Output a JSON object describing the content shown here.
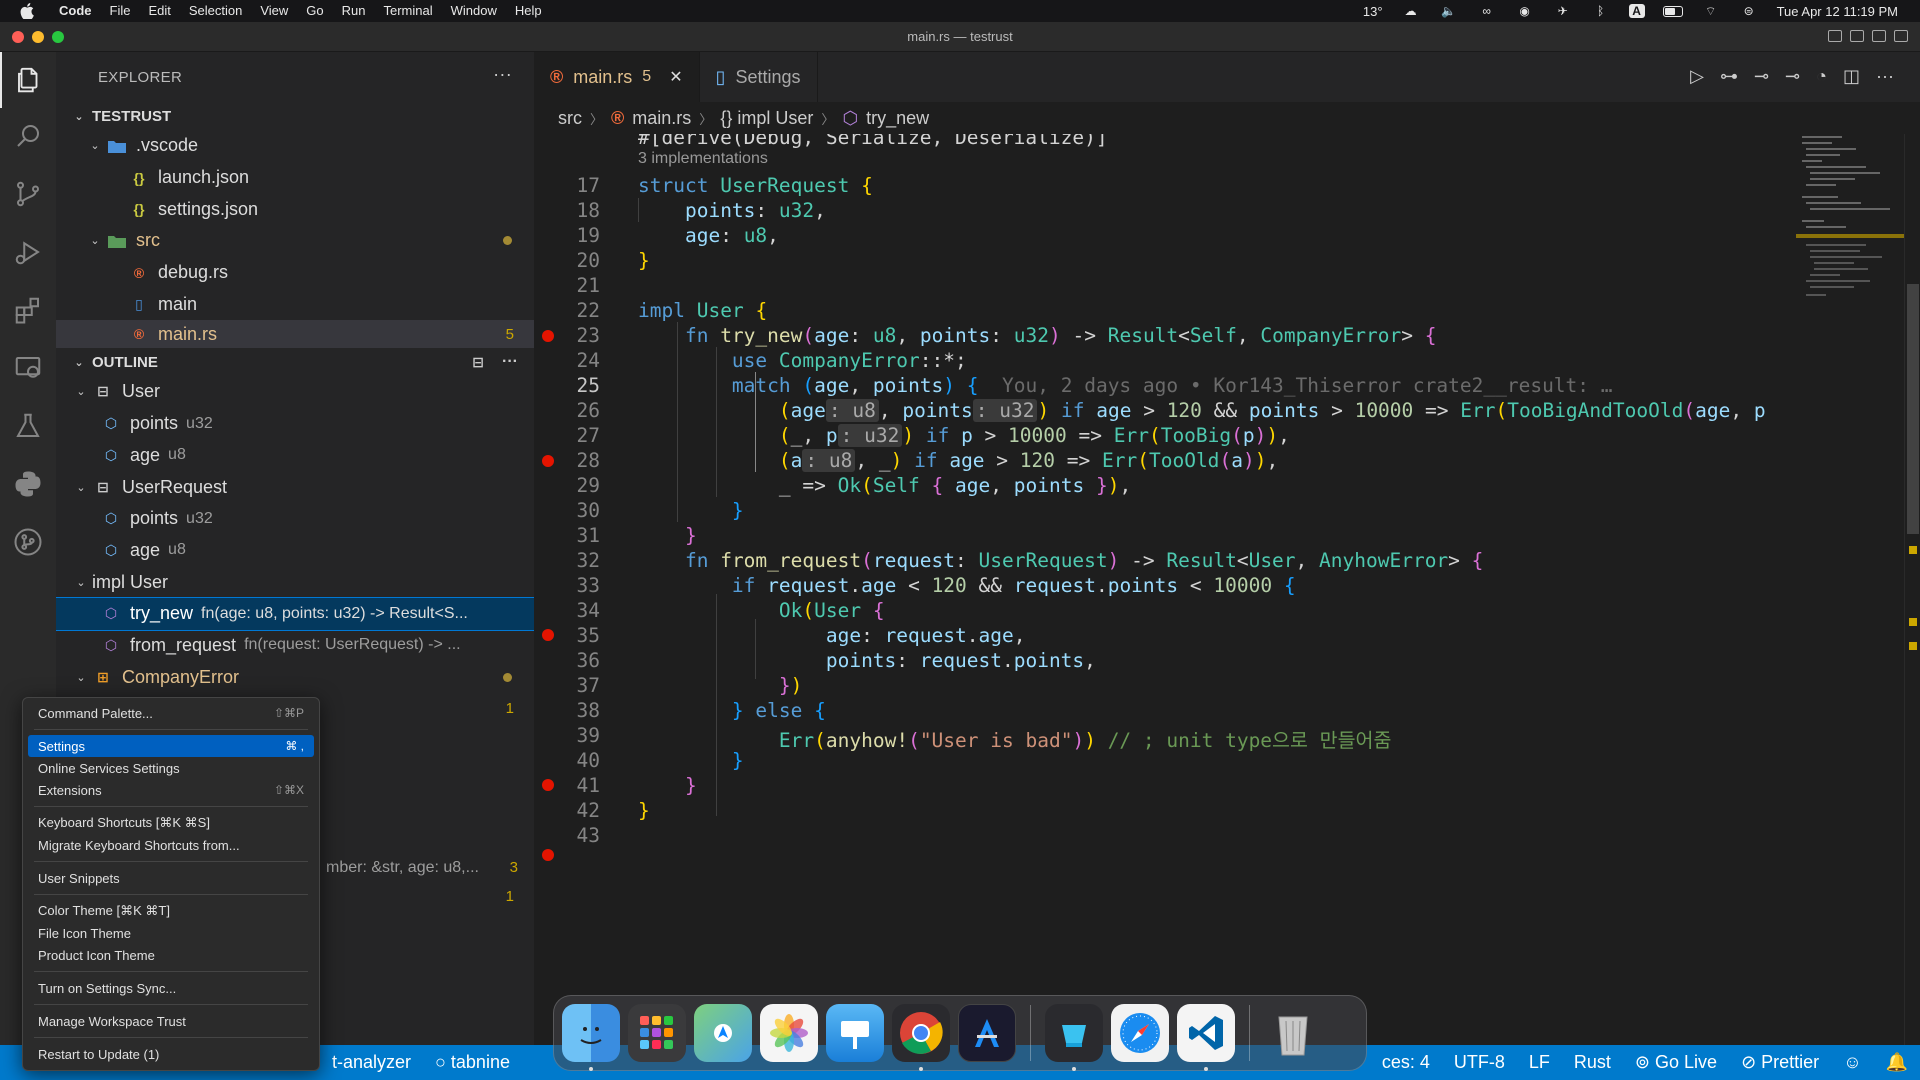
{
  "menubar": {
    "app": "Code",
    "items": [
      "File",
      "Edit",
      "Selection",
      "View",
      "Go",
      "Run",
      "Terminal",
      "Window",
      "Help"
    ],
    "weather": "13°",
    "datetime": "Tue Apr 12  11:19 PM"
  },
  "window": {
    "title": "main.rs — testrust"
  },
  "sidebar": {
    "explorer_title": "EXPLORER",
    "project": "TESTRUST",
    "tree": [
      {
        "label": ".vscode",
        "kind": "folder"
      },
      {
        "label": "launch.json",
        "kind": "json"
      },
      {
        "label": "settings.json",
        "kind": "json"
      },
      {
        "label": "src",
        "kind": "folder"
      },
      {
        "label": "debug.rs",
        "kind": "rust"
      },
      {
        "label": "main",
        "kind": "file"
      },
      {
        "label": "main.rs",
        "kind": "rust",
        "badge": "5"
      }
    ],
    "outline_title": "OUTLINE",
    "outline": [
      {
        "label": "User",
        "detail": ""
      },
      {
        "label": "points",
        "detail": "u32"
      },
      {
        "label": "age",
        "detail": "u8"
      },
      {
        "label": "UserRequest",
        "detail": ""
      },
      {
        "label": "points",
        "detail": "u32"
      },
      {
        "label": "age",
        "detail": "u8"
      },
      {
        "label": "impl User",
        "detail": ""
      },
      {
        "label": "try_new",
        "detail": "fn(age: u8, points: u32) -> Result<S..."
      },
      {
        "label": "from_request",
        "detail": "fn(request: UserRequest) -> ..."
      },
      {
        "label": "CompanyError",
        "detail": ""
      }
    ],
    "partial_rows": [
      {
        "detail": "mber: &str, age: u8,...",
        "badge": "3"
      },
      {
        "badge": "1"
      },
      {
        "badge": "1"
      }
    ]
  },
  "tabs": [
    {
      "label": "main.rs",
      "count": "5",
      "active": true
    },
    {
      "label": "Settings",
      "active": false
    }
  ],
  "breadcrumbs": [
    "src",
    "main.rs",
    "{} impl User",
    "try_new"
  ],
  "editor": {
    "partial_line": "#[derive(Debug, Serialize, Deserialize)]",
    "codelens": "3 implementations",
    "line_numbers": [
      "17",
      "18",
      "19",
      "20",
      "21",
      "22",
      "23",
      "24",
      "25",
      "26",
      "27",
      "28",
      "29",
      "30",
      "31",
      "32",
      "33",
      "34",
      "35",
      "36",
      "37",
      "38",
      "39",
      "40",
      "41",
      "42",
      "43"
    ],
    "blame": "You, 2 days ago • Kor143_Thiserror crate2__result: …",
    "string_literal": "\"User is bad\"",
    "comment": "// ; unit type으로 만들어줌"
  },
  "context_menu": {
    "items": [
      {
        "label": "Command Palette...",
        "shortcut": "⇧⌘P"
      },
      {
        "label": "Settings",
        "shortcut": "⌘ ,",
        "selected": true
      },
      {
        "label": "Online Services Settings",
        "shortcut": ""
      },
      {
        "label": "Extensions",
        "shortcut": "⇧⌘X"
      },
      {
        "label": "Keyboard Shortcuts [⌘K ⌘S]",
        "shortcut": ""
      },
      {
        "label": "Migrate Keyboard Shortcuts from...",
        "shortcut": ""
      },
      {
        "label": "User Snippets",
        "shortcut": ""
      },
      {
        "label": "Color Theme [⌘K ⌘T]",
        "shortcut": ""
      },
      {
        "label": "File Icon Theme",
        "shortcut": ""
      },
      {
        "label": "Product Icon Theme",
        "shortcut": ""
      },
      {
        "label": "Turn on Settings Sync...",
        "shortcut": ""
      },
      {
        "label": "Manage Workspace Trust",
        "shortcut": ""
      },
      {
        "label": "Restart to Update (1)",
        "shortcut": ""
      }
    ]
  },
  "statusbar": {
    "left": [
      "t-analyzer",
      "tabnine"
    ],
    "right": [
      "ces: 4",
      "UTF-8",
      "LF",
      "Rust",
      "Go Live",
      "Prettier"
    ]
  },
  "dock": [
    "finder-icon",
    "launchpad-icon",
    "maps-icon",
    "photos-icon",
    "keynote-icon",
    "chrome-icon",
    "xcode-icon",
    "dropzone-icon",
    "safari-icon",
    "vscode-icon",
    "trash-icon"
  ],
  "colors": {
    "accent": "#007acc",
    "selection": "#04395e",
    "modified": "#e2c08d",
    "breakpoint": "#e51400"
  }
}
